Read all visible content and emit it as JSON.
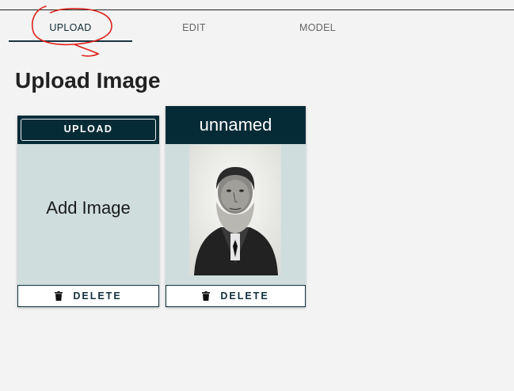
{
  "tabs": [
    {
      "label": "UPLOAD",
      "active": true
    },
    {
      "label": "EDIT",
      "active": false
    },
    {
      "label": "MODEL",
      "active": false
    }
  ],
  "page": {
    "title": "Upload Image"
  },
  "cards": {
    "upload_card": {
      "upload_label": "UPLOAD",
      "placeholder_text": "Add Image",
      "delete_label": "DELETE"
    },
    "image_card": {
      "name": "unnamed",
      "delete_label": "DELETE",
      "image_subject": "vintage black-and-white portrait photograph of a bearded man"
    }
  },
  "colors": {
    "header_dark": "#052b37",
    "card_background": "#cfdddd",
    "page_background": "#f3f3f3",
    "annotation_red": "#e0201c"
  }
}
